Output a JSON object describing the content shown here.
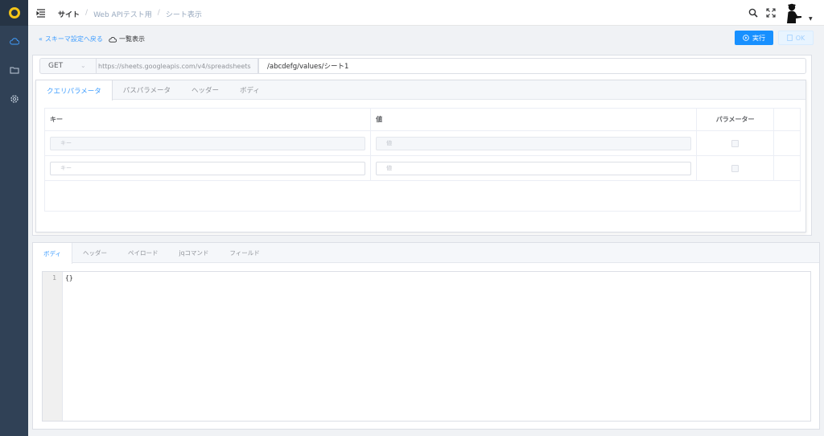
{
  "header": {
    "breadcrumb": [
      "サイト",
      "Web APIテスト用",
      "シート表示"
    ]
  },
  "toolbar": {
    "back_label": "スキーマ設定へ戻る",
    "view_label": "一覧表示",
    "run_label": "実行",
    "ok_label": "OK"
  },
  "request": {
    "method": "GET",
    "base_url": "https://sheets.googleapis.com/v4/spreadsheets",
    "path": "/abcdefg/values/シート1"
  },
  "param_tabs": [
    "クエリパラメータ",
    "パスパラメータ",
    "ヘッダー",
    "ボディ"
  ],
  "param_table": {
    "headers": [
      "キー",
      "値",
      "パラメーター"
    ],
    "rows": [
      {
        "key_placeholder": "キー",
        "value_placeholder": "値"
      },
      {
        "key_placeholder": "キー",
        "value_placeholder": "値"
      }
    ]
  },
  "response_tabs": [
    "ボディ",
    "ヘッダー",
    "ペイロード",
    "jqコマンド",
    "フィールド"
  ],
  "editor": {
    "line_number": "1",
    "content": "{}"
  },
  "colors": {
    "primary": "#1890ff",
    "sidebar": "#304156",
    "logo_ring": "#f5c518"
  }
}
